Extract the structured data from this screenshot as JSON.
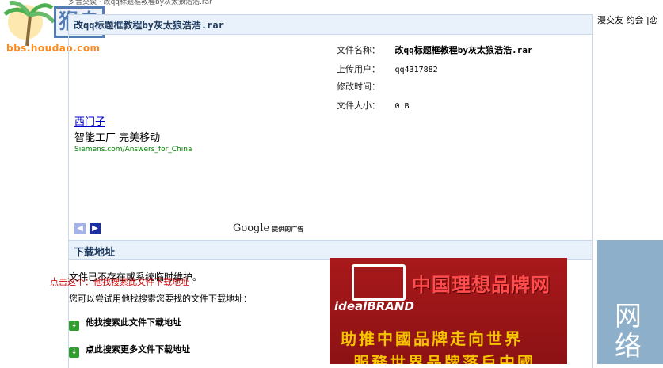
{
  "top": {
    "snippet": "乡音交谈 · 改qq标题框教程by灰太狼浩浩.rar"
  },
  "logo": {
    "mark": "猴岛",
    "url": "bbs.houdao.com"
  },
  "file": {
    "title": "改qq标题框教程by灰太狼浩浩.rar",
    "rows": [
      {
        "label": "文件名称：",
        "value": "改qq标题框教程by灰太狼浩浩.rar"
      },
      {
        "label": "上传用户：",
        "value": "qq4317882"
      },
      {
        "label": "修改时间：",
        "value": ""
      },
      {
        "label": "文件大小：",
        "value": "0 B"
      }
    ]
  },
  "ad": {
    "line1": "西门子",
    "line2": "智能工厂 完美移动",
    "line3": "Siemens.com/Answers_for_China",
    "prev": "◀",
    "next": "▶",
    "google": "Google",
    "provided": "提供的广告"
  },
  "download": {
    "title": "下载地址",
    "notice": "文件已不存在或系统临时维护。",
    "hint": "您可以尝试用他找搜索您要找的文件下载地址：",
    "red_link": "点击这个：他找搜索此文件下载地址",
    "link1": "他找搜索此文件下载地址",
    "link2": "点此搜索更多文件下载地址",
    "icon": "↓"
  },
  "banner": {
    "brand": "idealBRAND",
    "title": "中国理想品牌网",
    "slogan1": "助推中國品牌走向世界",
    "slogan2": "服務世界品牌落戶中國"
  },
  "right": {
    "nav": "漫交友 约会 |恋",
    "vertical": "网\n络"
  }
}
